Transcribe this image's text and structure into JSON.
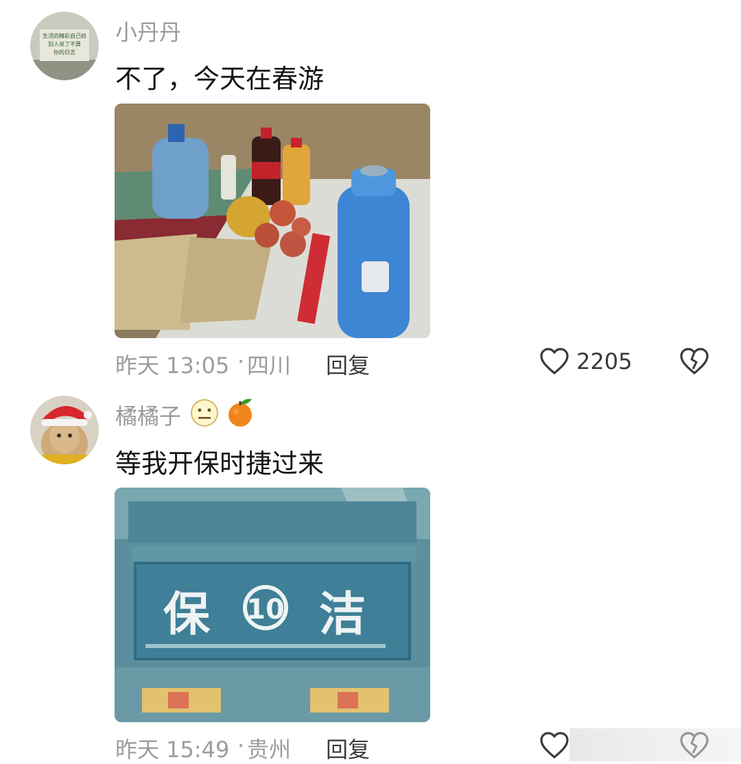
{
  "comments": [
    {
      "username": "小丹丹",
      "text": "不了，今天在春游",
      "timestamp": "昨天 13:05",
      "location": "四川",
      "reply_label": "回复",
      "like_count": "2205",
      "avatar_text": "生活的精彩自己给 别人说了不算 你的日志"
    },
    {
      "username": "橘橘子",
      "text": "等我开保时捷过来",
      "timestamp": "昨天 15:49",
      "location": "贵州",
      "reply_label": "回复",
      "truck_sign": {
        "left": "保",
        "number": "10",
        "right": "洁"
      }
    }
  ],
  "colors": {
    "username": "#9a9a9a",
    "text": "#141414",
    "meta": "#9c9c9c",
    "truck": "#3f7f97"
  },
  "icons": [
    "heart-icon",
    "broken-heart-icon",
    "neutral-face-emoji",
    "tangerine-emoji"
  ]
}
